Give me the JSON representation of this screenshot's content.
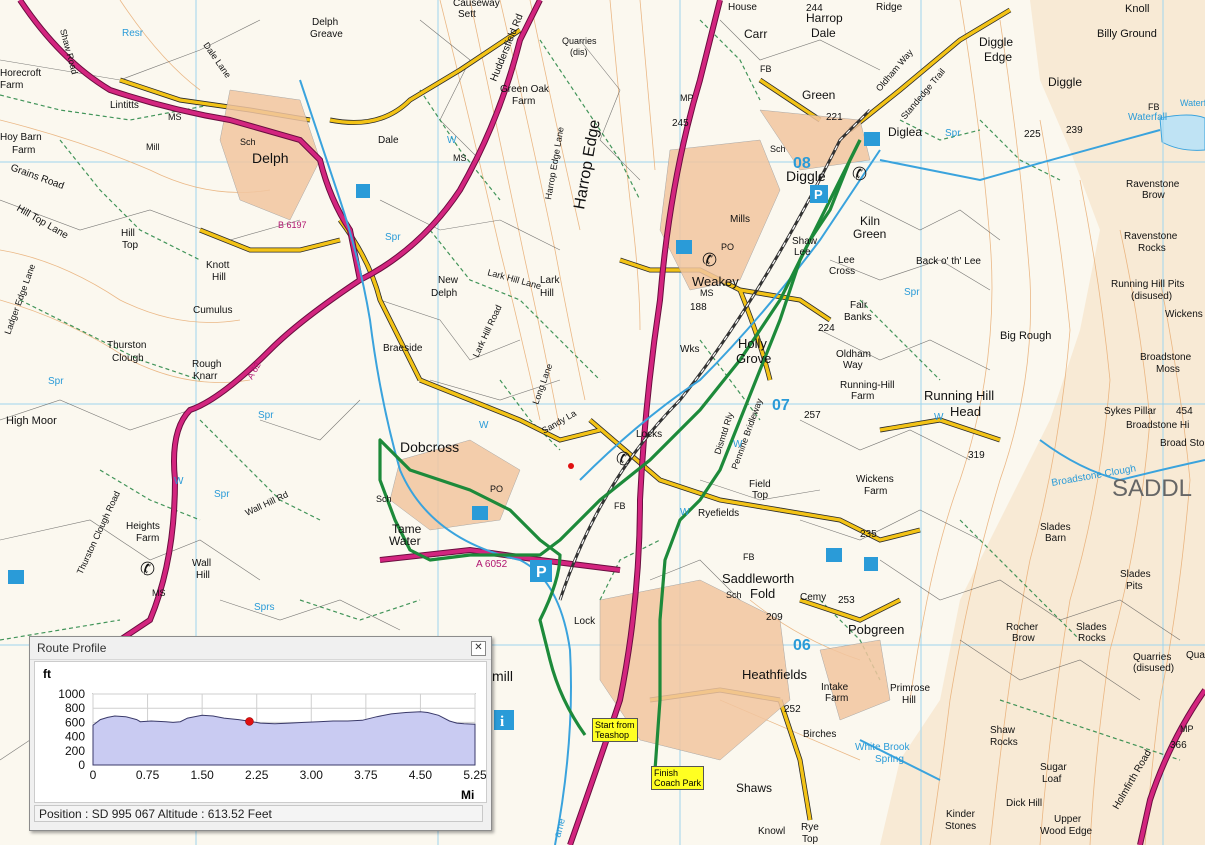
{
  "map": {
    "places_large": [
      {
        "t": "Delph"
      },
      {
        "t": "Diggle"
      },
      {
        "t": "Dobcross"
      },
      {
        "t": "Heathfields"
      },
      {
        "t": "Harrop Edge"
      },
      {
        "t": "SADDL"
      },
      {
        "t": "Running Hill"
      },
      {
        "t": "Head"
      },
      {
        "t": "Holly"
      },
      {
        "t": "Grove"
      },
      {
        "t": "Weakey"
      },
      {
        "t": "Saddleworth"
      },
      {
        "t": "Fold"
      },
      {
        "t": "Pobgreen"
      },
      {
        "t": "Shaws"
      },
      {
        "t": "Tame"
      },
      {
        "t": "Water"
      },
      {
        "t": "Kiln"
      },
      {
        "t": "Green"
      },
      {
        "t": "Harrop"
      },
      {
        "t": "Dale"
      },
      {
        "t": "Green"
      },
      {
        "t": "Diggle"
      },
      {
        "t": "Edge"
      },
      {
        "t": "Diglea"
      },
      {
        "t": "Carr"
      },
      {
        "t": "Diggle"
      },
      {
        "t": "Knoll"
      },
      {
        "t": "Billy Ground"
      },
      {
        "t": "High Moor"
      },
      {
        "t": "Big Rough"
      },
      {
        "t": "Lee"
      },
      {
        "t": "Cross"
      },
      {
        "t": "Back o' th' Lee"
      },
      {
        "t": "Fair"
      },
      {
        "t": "Banks"
      },
      {
        "t": "Ravenstone"
      },
      {
        "t": "Rocks"
      },
      {
        "t": "Broadstone"
      },
      {
        "t": "Moss"
      },
      {
        "t": "Primrose"
      },
      {
        "t": "Hill"
      },
      {
        "t": "Rocher"
      },
      {
        "t": "Brow"
      },
      {
        "t": "Slades"
      },
      {
        "t": "Rocks"
      },
      {
        "t": "Shaw"
      },
      {
        "t": "Rocks"
      },
      {
        "t": "Sugar"
      },
      {
        "t": "Loaf"
      },
      {
        "t": "Dick Hill"
      },
      {
        "t": "Upper"
      },
      {
        "t": "Wood Edge"
      },
      {
        "t": "Kinder"
      },
      {
        "t": "Stones"
      },
      {
        "t": "New"
      },
      {
        "t": "Delph"
      },
      {
        "t": "Lark"
      },
      {
        "t": "Hill"
      },
      {
        "t": "Knott"
      },
      {
        "t": "Hill"
      },
      {
        "t": "Cumulus"
      },
      {
        "t": "Thurston"
      },
      {
        "t": "Clough"
      },
      {
        "t": "Rough"
      },
      {
        "t": "Knarr"
      },
      {
        "t": "Braeside"
      },
      {
        "t": "Wickens"
      },
      {
        "t": "Farm"
      },
      {
        "t": "Running-Hill"
      },
      {
        "t": "Farm"
      },
      {
        "t": "Field"
      },
      {
        "t": "Top"
      },
      {
        "t": "Ryefields"
      },
      {
        "t": "Heights"
      },
      {
        "t": "Farm"
      },
      {
        "t": "Wall"
      },
      {
        "t": "Hill"
      },
      {
        "t": "Hill"
      },
      {
        "t": "Top"
      },
      {
        "t": "Hill Top Lane"
      },
      {
        "t": "Grains Road"
      },
      {
        "t": "Hoy Barn"
      },
      {
        "t": "Farm"
      },
      {
        "t": "Delph"
      },
      {
        "t": "Greave"
      },
      {
        "t": "Green Oak"
      },
      {
        "t": "Farm"
      },
      {
        "t": "Dale"
      },
      {
        "t": "Lintitts"
      },
      {
        "t": "Slades"
      },
      {
        "t": "Barn"
      },
      {
        "t": "Slades"
      },
      {
        "t": "Pits"
      },
      {
        "t": "Intake"
      },
      {
        "t": "Farm"
      },
      {
        "t": "Birches"
      },
      {
        "t": "Knowl"
      },
      {
        "t": "Rye"
      },
      {
        "t": "Top"
      },
      {
        "t": "Quarries"
      },
      {
        "t": "(disused)"
      },
      {
        "t": "Running Hill Pits"
      },
      {
        "t": "(disused)"
      },
      {
        "t": "Broadstone Hi"
      },
      {
        "t": "Broad Sto"
      },
      {
        "t": "Sykes Pillar"
      },
      {
        "t": "Ravenstone"
      },
      {
        "t": "Brow"
      },
      {
        "t": "Oldham"
      },
      {
        "t": "Way"
      },
      {
        "t": "Locks"
      },
      {
        "t": "Lock"
      },
      {
        "t": "Mills"
      },
      {
        "t": "Wks"
      },
      {
        "t": "Shaw"
      },
      {
        "t": "Lee"
      },
      {
        "t": "Cemy"
      },
      {
        "t": "Causeway"
      },
      {
        "t": "Sett"
      },
      {
        "t": "House"
      },
      {
        "t": "Ridge"
      },
      {
        "t": "Quarries"
      },
      {
        "t": "(dis)"
      },
      {
        "t": "Waterfall"
      },
      {
        "t": "Sch"
      },
      {
        "t": "Sch"
      },
      {
        "t": "Sch"
      },
      {
        "t": "Sch"
      },
      {
        "t": "MS"
      },
      {
        "t": "MS"
      },
      {
        "t": "MS"
      },
      {
        "t": "MS"
      },
      {
        "t": "PO"
      },
      {
        "t": "PO"
      },
      {
        "t": "FB"
      },
      {
        "t": "FB"
      },
      {
        "t": "FB"
      },
      {
        "t": "FB"
      },
      {
        "t": "MP"
      },
      {
        "t": "MP"
      },
      {
        "t": "Mill"
      },
      {
        "t": "mill"
      },
      {
        "t": "Wickens"
      },
      {
        "t": "Quarries"
      },
      {
        "t": "Thurston Clough Road"
      },
      {
        "t": "Wall Hill Rd"
      },
      {
        "t": "Lark Hill Road"
      },
      {
        "t": "Lark Hill Lane"
      },
      {
        "t": "Sandy La"
      },
      {
        "t": "Long Lane"
      },
      {
        "t": "Harrop Edge Lane"
      },
      {
        "t": "Pennine Bridleway"
      },
      {
        "t": "Dismtd Rly"
      },
      {
        "t": "Standedge Trail"
      },
      {
        "t": "Oldham Way"
      },
      {
        "t": "Huddersfield Rd"
      },
      {
        "t": "Holmfirth Road"
      },
      {
        "t": "Dale Lane"
      },
      {
        "t": "Ladger Edge Lane"
      },
      {
        "t": "Shaw Road"
      },
      {
        "t": "Horecroft"
      },
      {
        "t": "Farm"
      },
      {
        "t": "A 6052"
      },
      {
        "t": "B 6197"
      },
      {
        "t": "A 62"
      },
      {
        "t": "ame"
      }
    ],
    "spot_heights": [
      "244",
      "245",
      "224",
      "257",
      "253",
      "252",
      "235",
      "225",
      "239",
      "319",
      "454",
      "366",
      "209",
      "188",
      "221"
    ],
    "water_labels": [
      "Resr",
      "Spr",
      "Spr",
      "Spr",
      "Spr",
      "Spr",
      "Spr",
      "Sprs",
      "W",
      "W",
      "W",
      "W",
      "W",
      "W",
      "Waterfall",
      "Broadstone Clough",
      "White Brook",
      "Spring"
    ],
    "grid_numbers": [
      "08",
      "07",
      "06"
    ],
    "start_label": "Start from\nTeashop",
    "finish_label": "Finish\nCoach Park",
    "colors": {
      "route": "#1d8a3a",
      "major_road": "#c0197a",
      "minor_road": "#f3c316",
      "grid": "#9fd5ee",
      "contour": "#e3a062",
      "field": "#3a3a3a",
      "water": "#3aa3dd",
      "moor": "#f6e2c4"
    }
  },
  "profile": {
    "title": "Route Profile",
    "close_label": "✕",
    "unit_y": "ft",
    "unit_x": "Mi",
    "status": "Position : SD 995 067 Altitude : 613.52 Feet",
    "marker": {
      "x": 2.15,
      "y": 613.52
    }
  },
  "chart_data": {
    "type": "area",
    "title": "Route Profile",
    "xlabel": "Mi",
    "ylabel": "ft",
    "xlim": [
      0,
      5.25
    ],
    "ylim": [
      0,
      1000
    ],
    "xticks": [
      "0",
      "0.75",
      "1.50",
      "2.25",
      "3.00",
      "3.75",
      "4.50",
      "5.25"
    ],
    "yticks": [
      "1000",
      "800",
      "600",
      "400",
      "200",
      "0"
    ],
    "series": [
      {
        "x": [
          0,
          0.1,
          0.2,
          0.3,
          0.45,
          0.6,
          0.65,
          0.8,
          1.0,
          1.1,
          1.2,
          1.3,
          1.5,
          1.65,
          1.8,
          2.0,
          2.15,
          2.3,
          2.5,
          2.7,
          2.9,
          3.1,
          3.3,
          3.5,
          3.7,
          3.9,
          4.1,
          4.3,
          4.5,
          4.6,
          4.75,
          4.9,
          5.0,
          5.1,
          5.25
        ],
        "y": [
          560,
          640,
          670,
          690,
          680,
          640,
          610,
          620,
          610,
          600,
          610,
          660,
          700,
          690,
          660,
          640,
          615,
          590,
          580,
          590,
          600,
          610,
          620,
          620,
          630,
          680,
          720,
          740,
          750,
          740,
          700,
          620,
          590,
          580,
          575
        ]
      }
    ],
    "grid": true
  }
}
